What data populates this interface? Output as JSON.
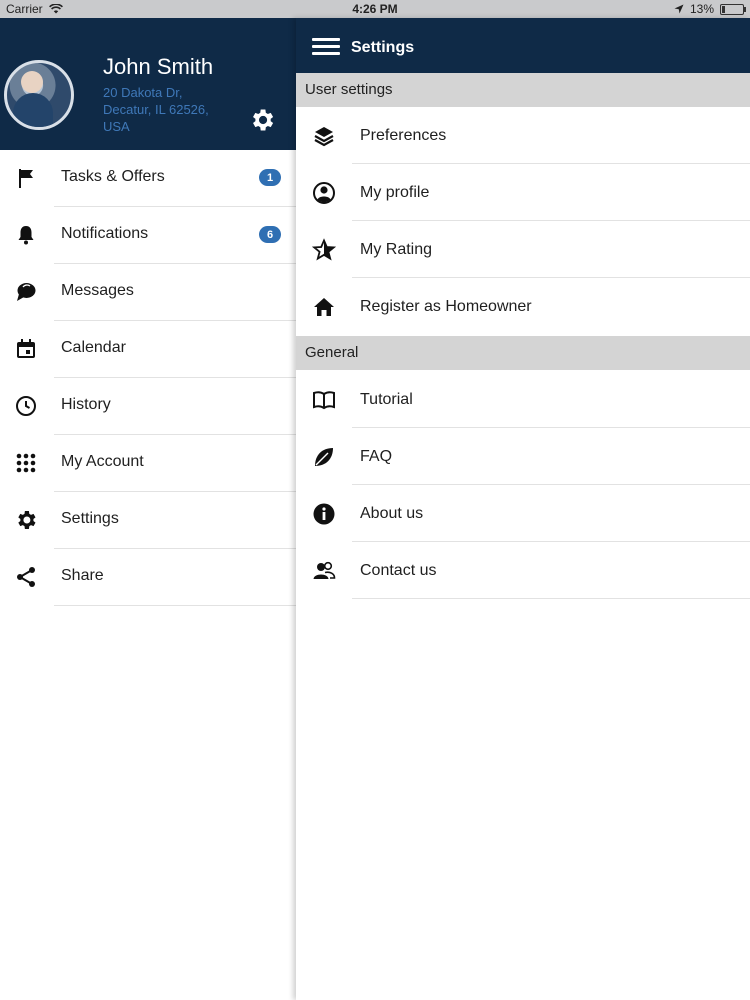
{
  "status_bar": {
    "carrier": "Carrier",
    "time": "4:26 PM",
    "battery": "13%",
    "battery_level": 0.13
  },
  "user": {
    "name": "John Smith",
    "address_line1": "20 Dakota Dr,",
    "address_line2": "Decatur, IL 62526,",
    "address_line3": "USA"
  },
  "drawer": {
    "items": [
      {
        "label": "Tasks & Offers",
        "icon": "flag-icon",
        "badge": "1"
      },
      {
        "label": "Notifications",
        "icon": "bell-icon",
        "badge": "6"
      },
      {
        "label": "Messages",
        "icon": "chat-icon"
      },
      {
        "label": "Calendar",
        "icon": "calendar-icon"
      },
      {
        "label": "History",
        "icon": "clock-icon"
      },
      {
        "label": "My Account",
        "icon": "grid-icon"
      },
      {
        "label": "Settings",
        "icon": "gear-icon"
      },
      {
        "label": "Share",
        "icon": "share-icon"
      }
    ]
  },
  "settings": {
    "title": "Settings",
    "user_section": {
      "heading": "User settings",
      "items": [
        {
          "label": "Preferences",
          "icon": "layers-icon"
        },
        {
          "label": "My profile",
          "icon": "user-circle-icon"
        },
        {
          "label": "My Rating",
          "icon": "star-icon"
        },
        {
          "label": "Register as Homeowner",
          "icon": "home-icon"
        }
      ]
    },
    "general_section": {
      "heading": "General",
      "items": [
        {
          "label": "Tutorial",
          "icon": "book-icon"
        },
        {
          "label": "FAQ",
          "icon": "leaf-icon"
        },
        {
          "label": "About us",
          "icon": "info-icon"
        },
        {
          "label": "Contact us",
          "icon": "contacts-icon"
        }
      ]
    }
  },
  "colors": {
    "header_bg": "#0f2a47",
    "accent": "#2f6fb3",
    "address": "#3f78b8",
    "section_bg": "#d4d4d4"
  }
}
